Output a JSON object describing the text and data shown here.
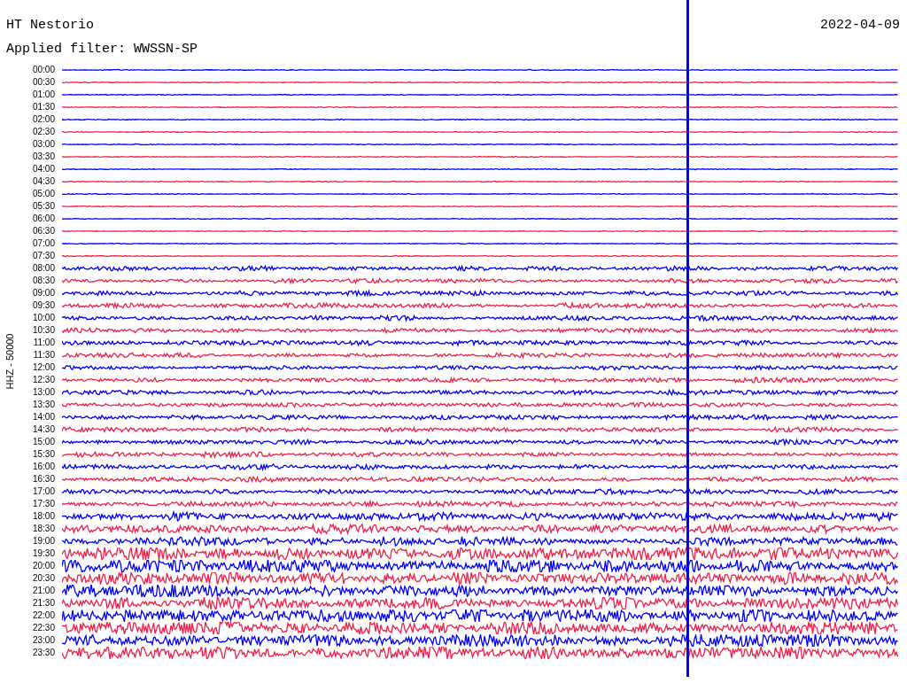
{
  "station": "HT Nestorio",
  "date": "2022-04-09",
  "filter": "Applied filter: WWSSN-SP",
  "axis_label": "HHZ - 50000",
  "rows": [
    {
      "time": "00:00",
      "color": "#0000ff"
    },
    {
      "time": "00:30",
      "color": "#f0204a"
    },
    {
      "time": "01:00",
      "color": "#0000ff"
    },
    {
      "time": "01:30",
      "color": "#f0204a"
    },
    {
      "time": "02:00",
      "color": "#0000ff"
    },
    {
      "time": "02:30",
      "color": "#f0204a"
    },
    {
      "time": "03:00",
      "color": "#0000ff"
    },
    {
      "time": "03:30",
      "color": "#f0204a"
    },
    {
      "time": "04:00",
      "color": "#0000ff"
    },
    {
      "time": "04:30",
      "color": "#f0204a"
    },
    {
      "time": "05:00",
      "color": "#0000ff"
    },
    {
      "time": "05:30",
      "color": "#f0204a"
    },
    {
      "time": "06:00",
      "color": "#0000ff"
    },
    {
      "time": "06:30",
      "color": "#f0204a"
    },
    {
      "time": "07:00",
      "color": "#0000ff"
    },
    {
      "time": "07:30",
      "color": "#f0204a"
    },
    {
      "time": "08:00",
      "color": "#0000ff"
    },
    {
      "time": "08:30",
      "color": "#f0204a"
    },
    {
      "time": "09:00",
      "color": "#0000ff"
    },
    {
      "time": "09:30",
      "color": "#f0204a"
    },
    {
      "time": "10:00",
      "color": "#0000ff"
    },
    {
      "time": "10:30",
      "color": "#f0204a"
    },
    {
      "time": "11:00",
      "color": "#0000ff"
    },
    {
      "time": "11:30",
      "color": "#f0204a"
    },
    {
      "time": "12:00",
      "color": "#0000ff"
    },
    {
      "time": "12:30",
      "color": "#f0204a"
    },
    {
      "time": "13:00",
      "color": "#0000ff"
    },
    {
      "time": "13:30",
      "color": "#f0204a"
    },
    {
      "time": "14:00",
      "color": "#0000ff"
    },
    {
      "time": "14:30",
      "color": "#f0204a"
    },
    {
      "time": "15:00",
      "color": "#0000ff"
    },
    {
      "time": "15:30",
      "color": "#f0204a"
    },
    {
      "time": "16:00",
      "color": "#0000ff"
    },
    {
      "time": "16:30",
      "color": "#f0204a"
    },
    {
      "time": "17:00",
      "color": "#0000ff"
    },
    {
      "time": "17:30",
      "color": "#f0204a"
    },
    {
      "time": "18:00",
      "color": "#0000ff"
    },
    {
      "time": "18:30",
      "color": "#f0204a"
    },
    {
      "time": "19:00",
      "color": "#0000ff"
    },
    {
      "time": "19:30",
      "color": "#f0204a"
    },
    {
      "time": "20:00",
      "color": "#0000ff"
    },
    {
      "time": "20:30",
      "color": "#f0204a"
    },
    {
      "time": "21:00",
      "color": "#0000ff"
    },
    {
      "time": "21:30",
      "color": "#f0204a"
    },
    {
      "time": "22:00",
      "color": "#0000ff"
    },
    {
      "time": "22:30",
      "color": "#f0204a"
    },
    {
      "time": "23:00",
      "color": "#0000ff"
    },
    {
      "time": "23:30",
      "color": "#f0204a"
    }
  ]
}
